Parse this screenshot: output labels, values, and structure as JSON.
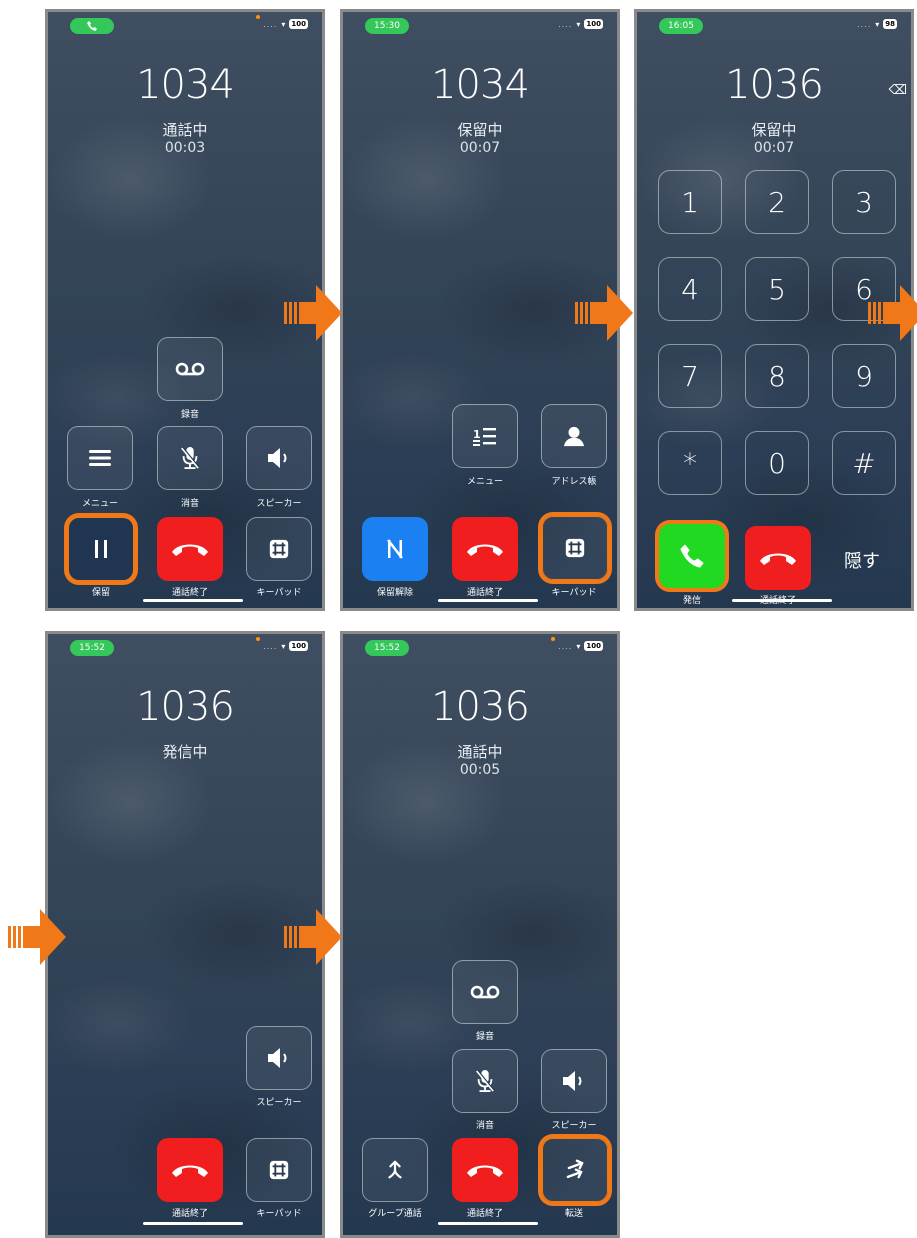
{
  "panels": [
    {
      "clock": "",
      "battery": "100",
      "number": "1034",
      "status": "通話中",
      "time": "00:03",
      "labels": {
        "record": "録音",
        "menu": "メニュー",
        "mute": "消音",
        "speaker": "スピーカー",
        "hold": "保留",
        "end": "通話終了",
        "keypad": "キーパッド"
      }
    },
    {
      "clock": "15:30",
      "battery": "100",
      "number": "1034",
      "status": "保留中",
      "time": "00:07",
      "labels": {
        "menu": "メニュー",
        "contacts": "アドレス帳",
        "unhold": "保留解除",
        "end": "通話終了",
        "keypad": "キーパッド"
      }
    },
    {
      "clock": "16:05",
      "battery": "98",
      "number": "1036",
      "status": "保留中",
      "time": "00:07",
      "keys": [
        "1",
        "2",
        "3",
        "4",
        "5",
        "6",
        "7",
        "8",
        "9",
        "*",
        "0",
        "#"
      ],
      "labels": {
        "dial": "発信",
        "end": "通話終了",
        "hide": "隠す"
      }
    },
    {
      "clock": "15:52",
      "battery": "100",
      "number": "1036",
      "status": "発信中",
      "labels": {
        "speaker": "スピーカー",
        "end": "通話終了",
        "keypad": "キーパッド"
      }
    },
    {
      "clock": "15:52",
      "battery": "100",
      "number": "1036",
      "status": "通話中",
      "time": "00:05",
      "labels": {
        "record": "録音",
        "mute": "消音",
        "speaker": "スピーカー",
        "group": "グループ通話",
        "end": "通話終了",
        "transfer": "転送"
      }
    }
  ],
  "colors": {
    "accent": "#f07818",
    "end_call": "#f01e1e",
    "dial": "#22d922",
    "unhold": "#1b80f2",
    "status_pill": "#34c759"
  }
}
